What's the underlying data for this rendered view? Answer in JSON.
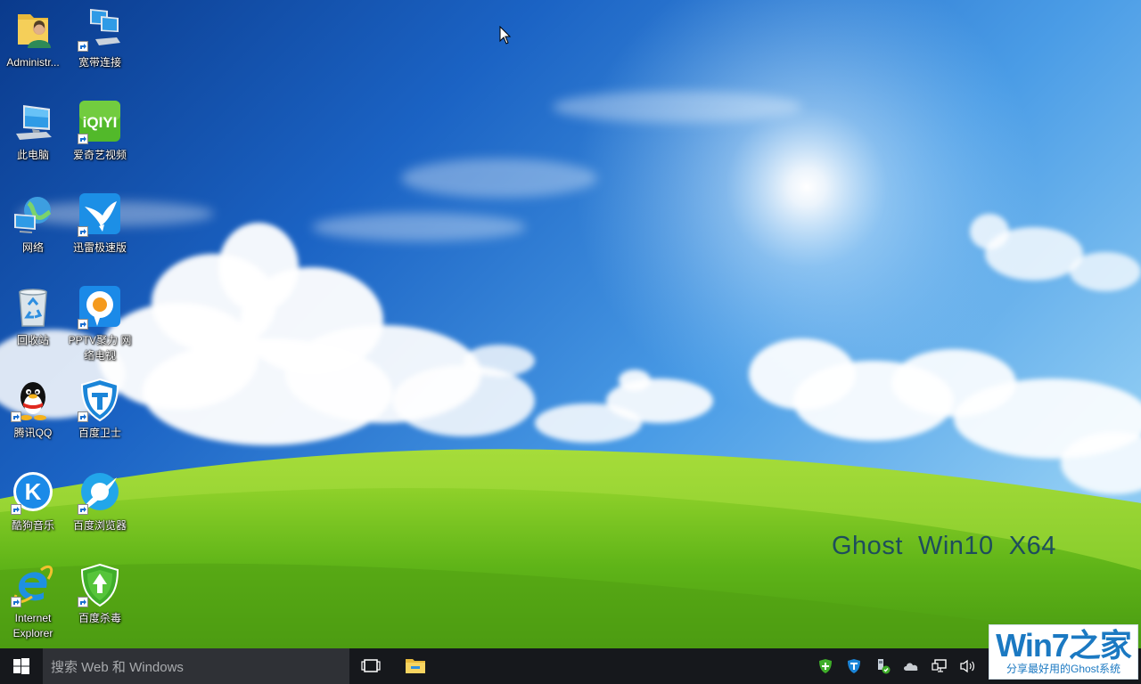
{
  "desktop": {
    "icons": [
      {
        "label": "Administr...",
        "icon": "user-folder-icon"
      },
      {
        "label": "宽带连接",
        "icon": "broadband-connection-icon"
      },
      {
        "label": "此电脑",
        "icon": "computer-icon"
      },
      {
        "label": "爱奇艺视频",
        "icon": "iqiyi-icon",
        "logo_text": "iQIYI"
      },
      {
        "label": "网络",
        "icon": "network-icon"
      },
      {
        "label": "迅雷极速版",
        "icon": "thunder-bird-icon"
      },
      {
        "label": "回收站",
        "icon": "recycle-bin-icon"
      },
      {
        "label": "PPTV聚力 网络电视",
        "icon": "pptv-icon"
      },
      {
        "label": "腾讯QQ",
        "icon": "qq-penguin-icon"
      },
      {
        "label": "百度卫士",
        "icon": "baidu-guard-shield-icon"
      },
      {
        "label": "酷狗音乐",
        "icon": "kugou-icon",
        "logo_text": "K"
      },
      {
        "label": "百度浏览器",
        "icon": "baidu-browser-icon"
      },
      {
        "label": "Internet Explorer",
        "icon": "internet-explorer-icon"
      },
      {
        "label": "百度杀毒",
        "icon": "baidu-antivirus-icon"
      }
    ],
    "wallpaper_caption": "Ghost  Win10  X64"
  },
  "taskbar": {
    "search_placeholder": "搜索 Web 和 Windows",
    "tray_icons": [
      "baidu-antivirus-tray-icon",
      "baidu-guard-tray-icon",
      "usb-device-tray-icon",
      "onedrive-icon",
      "network-tray-icon",
      "volume-icon"
    ]
  },
  "watermark": {
    "logo": "Win7之家",
    "tagline": "分享最好用的Ghost系统"
  },
  "colors": {
    "taskbar": "#16181c",
    "search_box": "#2f3136",
    "caption": "#1e4d5c",
    "watermark_blue": "#1b79c2"
  }
}
